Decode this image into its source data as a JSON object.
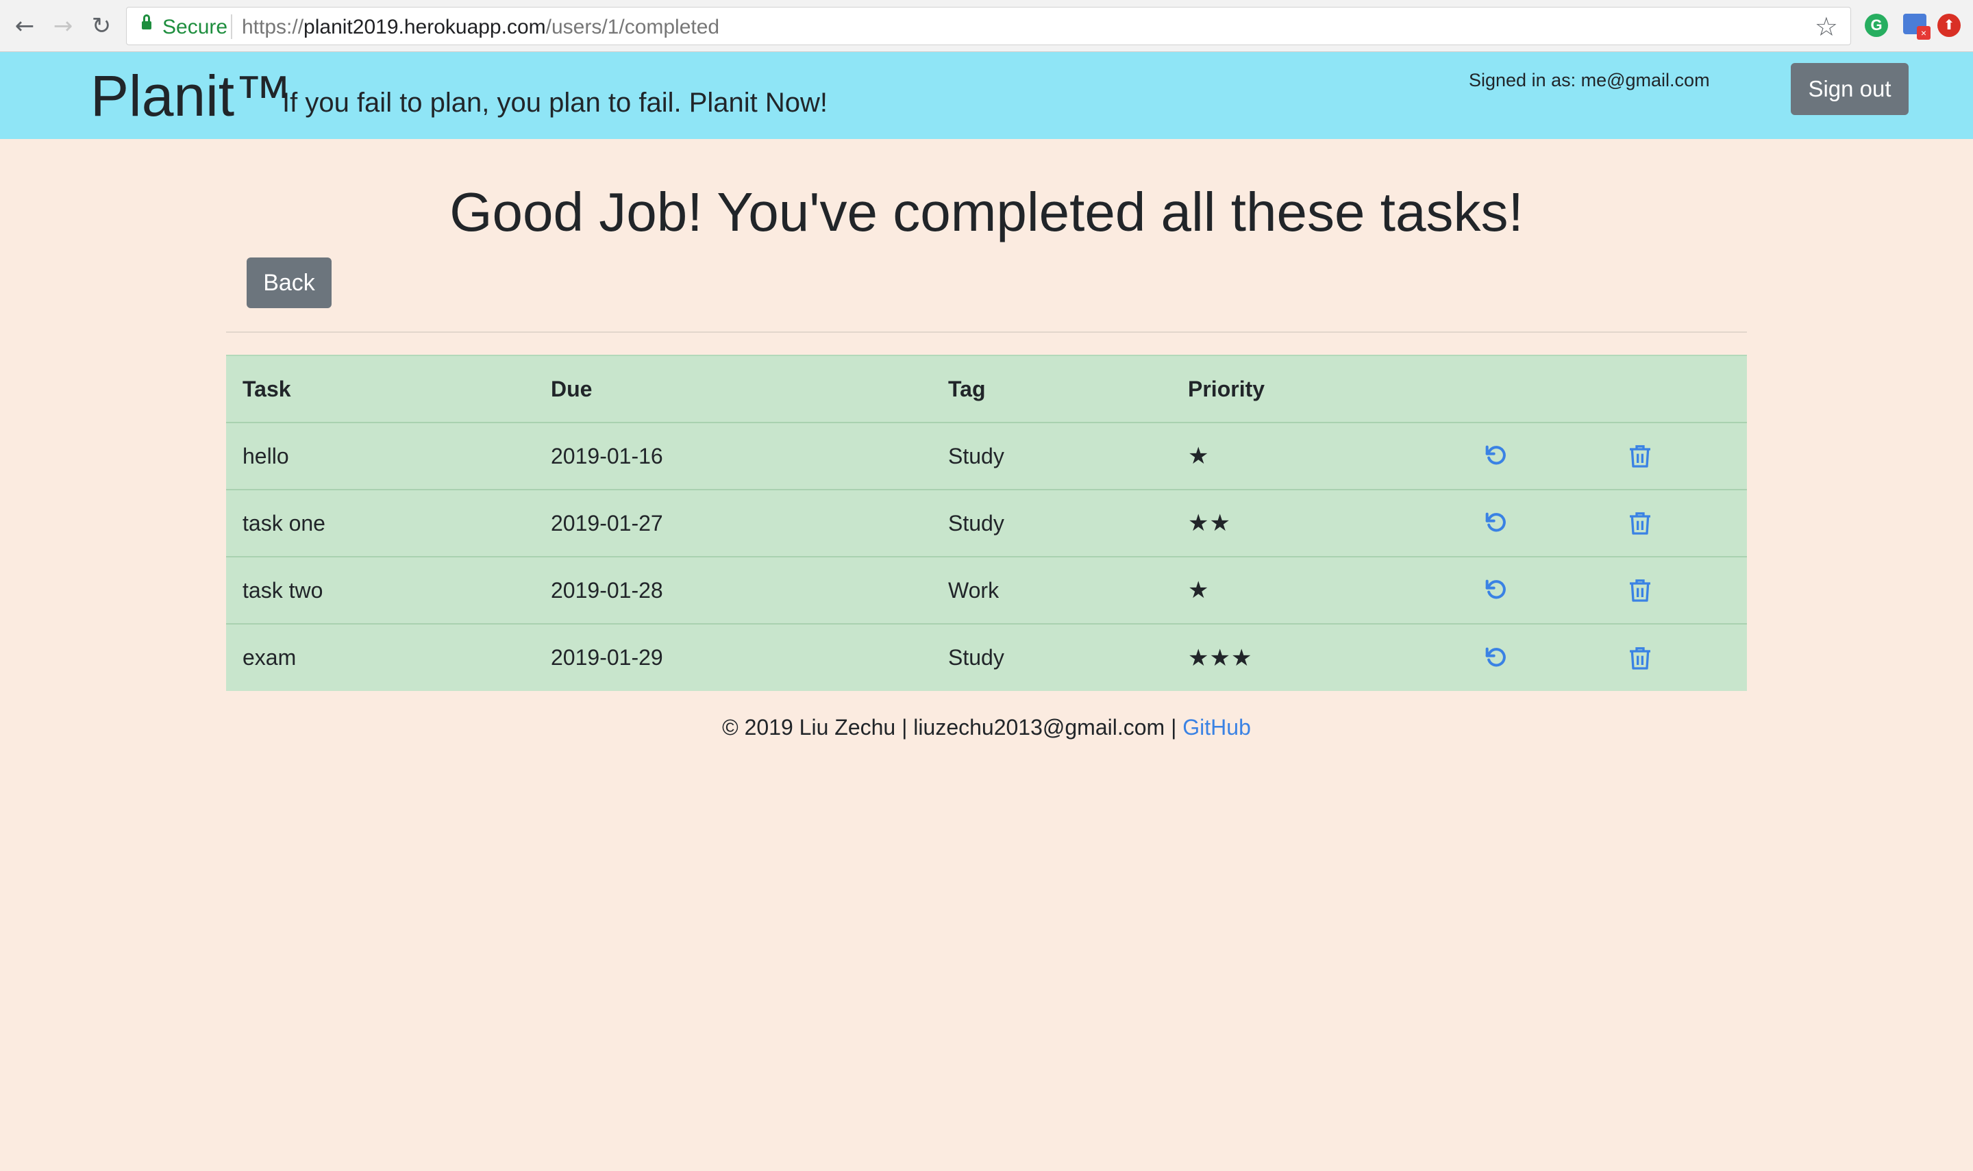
{
  "browser": {
    "secure_label": "Secure",
    "url_scheme": "https://",
    "url_host": "planit2019.herokuapp.com",
    "url_path": "/users/1/completed"
  },
  "header": {
    "brand": "Planit™",
    "tagline": "If you fail to plan, you plan to fail. Planit Now!",
    "signed_in": "Signed in as: me@gmail.com",
    "signout_label": "Sign out"
  },
  "main": {
    "heading": "Good Job! You've completed all these tasks!",
    "back_label": "Back"
  },
  "table": {
    "headers": [
      "Task",
      "Due",
      "Tag",
      "Priority"
    ],
    "rows": [
      {
        "task": "hello",
        "due": "2019-01-16",
        "tag": "Study",
        "priority": "★",
        "priority_level": 1
      },
      {
        "task": "task one",
        "due": "2019-01-27",
        "tag": "Study",
        "priority": "★★",
        "priority_level": 2
      },
      {
        "task": "task two",
        "due": "2019-01-28",
        "tag": "Work",
        "priority": "★",
        "priority_level": 1
      },
      {
        "task": "exam",
        "due": "2019-01-29",
        "tag": "Study",
        "priority": "★★★",
        "priority_level": 3
      }
    ],
    "row_icons": [
      "undo-icon",
      "trash-icon"
    ]
  },
  "footer": {
    "text": "© 2019 Liu Zechu | liuzechu2013@gmail.com | ",
    "link_label": "GitHub"
  },
  "colors": {
    "page_bg": "#fbebe0",
    "header_bg": "#8fe5f6",
    "table_bg": "#c8e5cc",
    "button_bg": "#6c757d",
    "link": "#3a82e4"
  }
}
